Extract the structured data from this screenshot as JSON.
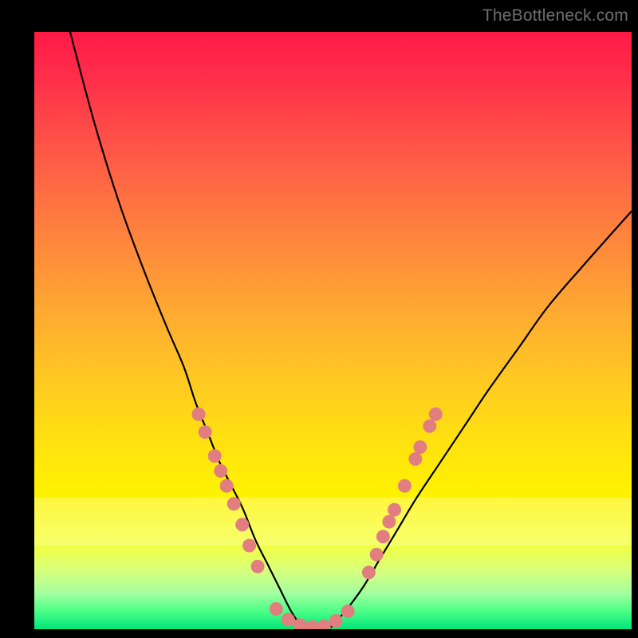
{
  "watermark": "TheBottleneck.com",
  "chart_data": {
    "type": "line",
    "title": "",
    "xlabel": "",
    "ylabel": "",
    "xlim": [
      0,
      100
    ],
    "ylim": [
      0,
      100
    ],
    "grid": false,
    "legend": false,
    "series": [
      {
        "name": "left-curve",
        "x": [
          6,
          10,
          14,
          18,
          22,
          25,
          27,
          29,
          31,
          33,
          35,
          37,
          39,
          41,
          43,
          45
        ],
        "y": [
          100,
          85,
          72,
          61,
          51,
          44,
          38,
          33,
          28,
          24,
          20,
          15,
          11,
          7,
          3,
          0
        ]
      },
      {
        "name": "right-curve",
        "x": [
          45,
          49,
          52,
          55,
          58,
          61,
          64,
          68,
          72,
          76,
          81,
          86,
          92,
          100
        ],
        "y": [
          0,
          0,
          3,
          7,
          12,
          17,
          22,
          28,
          34,
          40,
          47,
          54,
          61,
          70
        ]
      }
    ],
    "markers": [
      {
        "x": 27.5,
        "y": 36
      },
      {
        "x": 28.6,
        "y": 33
      },
      {
        "x": 30.2,
        "y": 29
      },
      {
        "x": 31.2,
        "y": 26.5
      },
      {
        "x": 32.2,
        "y": 24
      },
      {
        "x": 33.4,
        "y": 21
      },
      {
        "x": 34.8,
        "y": 17.5
      },
      {
        "x": 36.0,
        "y": 14
      },
      {
        "x": 37.4,
        "y": 10.5
      },
      {
        "x": 40.5,
        "y": 3.4
      },
      {
        "x": 42.5,
        "y": 1.6
      },
      {
        "x": 44.5,
        "y": 0.7
      },
      {
        "x": 46.5,
        "y": 0.4
      },
      {
        "x": 48.5,
        "y": 0.5
      },
      {
        "x": 50.5,
        "y": 1.4
      },
      {
        "x": 52.5,
        "y": 3.0
      },
      {
        "x": 56.0,
        "y": 9.5
      },
      {
        "x": 57.3,
        "y": 12.5
      },
      {
        "x": 58.4,
        "y": 15.5
      },
      {
        "x": 59.4,
        "y": 18
      },
      {
        "x": 60.3,
        "y": 20
      },
      {
        "x": 62.0,
        "y": 24
      },
      {
        "x": 63.8,
        "y": 28.5
      },
      {
        "x": 64.6,
        "y": 30.5
      },
      {
        "x": 66.2,
        "y": 34
      },
      {
        "x": 67.2,
        "y": 36
      }
    ],
    "notes": "V-shaped bottleneck curve on rainbow heat gradient; minimum at x≈46 y≈0. Y is bottleneck percentage (0=green/good near bottom, 100=red/bad near top)."
  }
}
